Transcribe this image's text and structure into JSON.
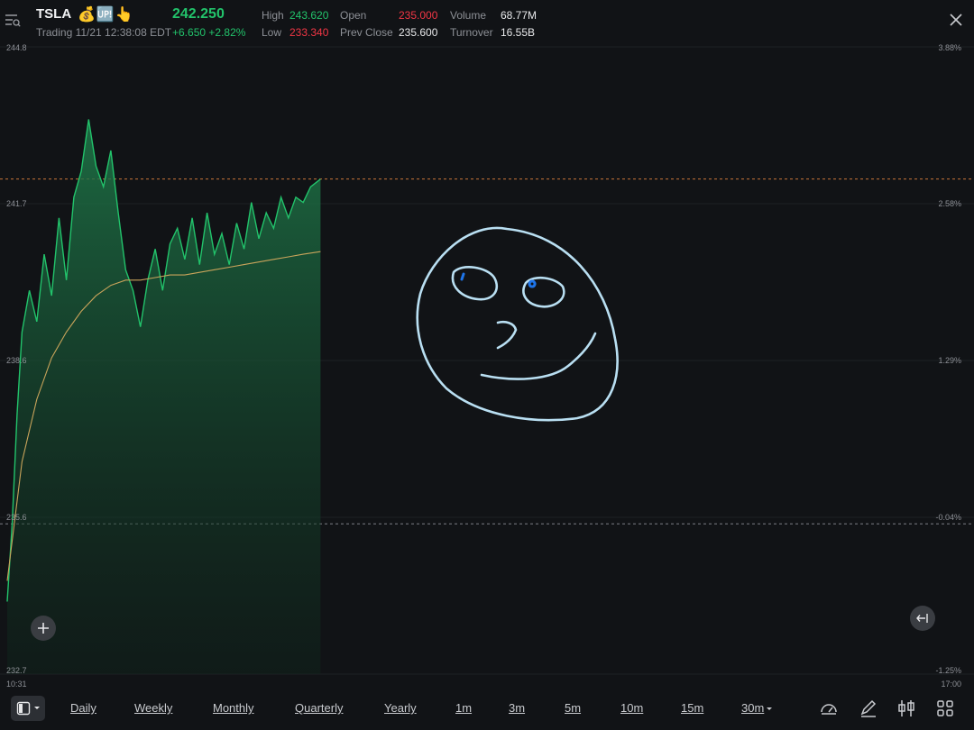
{
  "header": {
    "symbol": "TSLA",
    "badges": "💰🆙👆",
    "status": "Trading 11/21 12:38:08 EDT",
    "price": "242.250",
    "change": "+6.650",
    "change_pct": "+2.82%",
    "stats": {
      "high_label": "High",
      "high": "243.620",
      "low_label": "Low",
      "low": "233.340",
      "open_label": "Open",
      "open": "235.000",
      "prev_close_label": "Prev Close",
      "prev_close": "235.600",
      "volume_label": "Volume",
      "volume": "68.77M",
      "turnover_label": "Turnover",
      "turnover": "16.55B"
    }
  },
  "colors": {
    "up": "#22c36b",
    "down": "#f23645",
    "avg_line": "#c9a45b",
    "ref_line": "#c8743a",
    "prev_close_line": "#7c7f85",
    "drawing": "#b9dff2",
    "eye": "#1e74e8"
  },
  "chart_axes": {
    "left_ticks": [
      "244.8",
      "241.7",
      "238.6",
      "235.6",
      "232.7"
    ],
    "right_ticks": [
      "3.88%",
      "2.58%",
      "1.29%",
      "-0.04%",
      "-1.25%"
    ],
    "x_start": "10:31",
    "x_end": "17:00"
  },
  "chart_data": {
    "type": "area",
    "title": "",
    "xlabel": "",
    "ylabel": "",
    "x_range": [
      "10:31",
      "17:00"
    ],
    "ylim": [
      232.7,
      244.8
    ],
    "reference_lines": {
      "last_price": 242.25,
      "prev_close": 235.6
    },
    "series": [
      {
        "kind": "price",
        "x": [
          "10:31",
          "10:33",
          "10:35",
          "10:37",
          "10:40",
          "10:43",
          "10:46",
          "10:49",
          "10:52",
          "10:55",
          "10:58",
          "11:01",
          "11:04",
          "11:07",
          "11:10",
          "11:13",
          "11:16",
          "11:19",
          "11:22",
          "11:25",
          "11:28",
          "11:31",
          "11:34",
          "11:37",
          "11:40",
          "11:43",
          "11:46",
          "11:49",
          "11:52",
          "11:55",
          "11:58",
          "12:01",
          "12:04",
          "12:07",
          "12:10",
          "12:13",
          "12:16",
          "12:19",
          "12:22",
          "12:25",
          "12:28",
          "12:31",
          "12:34",
          "12:38"
        ],
        "values": [
          234.1,
          235.6,
          237.7,
          239.3,
          240.1,
          239.5,
          240.8,
          240.0,
          241.5,
          240.3,
          241.9,
          242.4,
          243.4,
          242.5,
          242.1,
          242.8,
          241.6,
          240.5,
          240.1,
          239.4,
          240.3,
          240.9,
          240.1,
          241.0,
          241.3,
          240.7,
          241.5,
          240.6,
          241.6,
          240.8,
          241.2,
          240.6,
          241.4,
          240.9,
          241.8,
          241.1,
          241.6,
          241.3,
          241.9,
          241.5,
          241.9,
          241.8,
          242.1,
          242.25
        ]
      },
      {
        "kind": "average",
        "x": [
          "10:31",
          "10:37",
          "10:43",
          "10:49",
          "10:55",
          "11:01",
          "11:07",
          "11:13",
          "11:19",
          "11:25",
          "11:31",
          "11:37",
          "11:43",
          "11:49",
          "11:55",
          "12:01",
          "12:07",
          "12:13",
          "12:19",
          "12:25",
          "12:31",
          "12:38"
        ],
        "values": [
          234.5,
          236.8,
          238.0,
          238.8,
          239.3,
          239.7,
          240.0,
          240.2,
          240.3,
          240.3,
          240.35,
          240.4,
          240.4,
          240.45,
          240.5,
          240.55,
          240.6,
          240.65,
          240.7,
          240.75,
          240.8,
          240.85
        ]
      }
    ]
  },
  "toolbar": {
    "periods": [
      "Daily",
      "Weekly",
      "Monthly",
      "Quarterly",
      "Yearly",
      "1m",
      "3m",
      "5m",
      "10m",
      "15m",
      "30m"
    ]
  }
}
